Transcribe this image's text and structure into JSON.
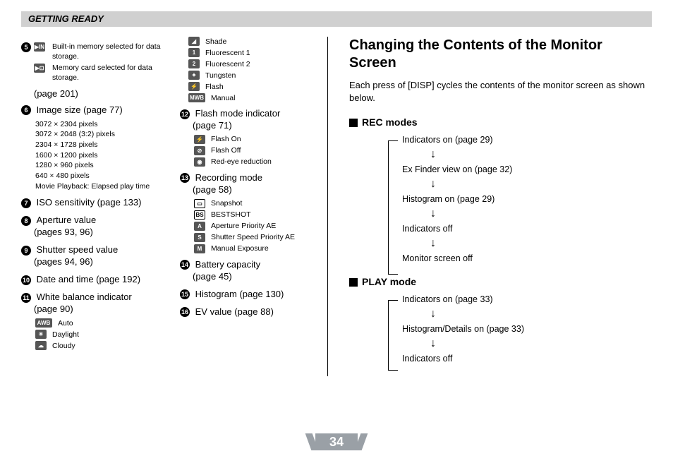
{
  "header": {
    "title": "GETTING READY"
  },
  "pageNumber": "34",
  "leftColumn": {
    "item5": {
      "num": "5",
      "memory1": {
        "icon": "IN",
        "text": "Built-in memory selected for data storage."
      },
      "memory2": {
        "icon": "⊡",
        "text": "Memory card selected for data storage."
      },
      "pageRef": "(page 201)"
    },
    "item6": {
      "num": "6",
      "label": "Image size (page 77)",
      "sizes": [
        "3072 × 2304 pixels",
        "3072 × 2048 (3:2) pixels",
        "2304 × 1728 pixels",
        "1600 × 1200 pixels",
        "1280 ×  960 pixels",
        " 640 ×  480 pixels",
        "Movie Playback: Elapsed play time"
      ]
    },
    "item7": {
      "num": "7",
      "label": "ISO sensitivity (page 133)"
    },
    "item8": {
      "num": "8",
      "label": "Aperture value",
      "sub": "(pages 93, 96)"
    },
    "item9": {
      "num": "9",
      "label": "Shutter speed value",
      "sub": "(pages 94, 96)"
    },
    "item10": {
      "num": "10",
      "label": "Date and time (page 192)"
    },
    "item11": {
      "num": "11",
      "label": "White balance indicator",
      "sub": "(page 90)",
      "options": [
        {
          "icon": "AWB",
          "label": "Auto"
        },
        {
          "icon": "☀",
          "label": "Daylight"
        },
        {
          "icon": "☁",
          "label": "Cloudy"
        }
      ]
    }
  },
  "midColumn": {
    "wbExtra": [
      {
        "icon": "◢",
        "label": "Shade"
      },
      {
        "icon": "1",
        "label": "Fluorescent 1"
      },
      {
        "icon": "2",
        "label": "Fluorescent 2"
      },
      {
        "icon": "✦",
        "label": "Tungsten"
      },
      {
        "icon": "⚡",
        "label": "Flash"
      },
      {
        "icon": "MWB",
        "label": "Manual"
      }
    ],
    "item12": {
      "num": "12",
      "label": "Flash mode indicator",
      "sub": "(page 71)",
      "options": [
        {
          "icon": "⚡",
          "label": "Flash On"
        },
        {
          "icon": "⊘",
          "label": "Flash Off"
        },
        {
          "icon": "◉",
          "label": "Red-eye reduction"
        }
      ]
    },
    "item13": {
      "num": "13",
      "label": "Recording mode",
      "sub": "(page 58)",
      "options": [
        {
          "icon": "▭",
          "label": "Snapshot"
        },
        {
          "icon": "BS",
          "label": "BESTSHOT"
        },
        {
          "icon": "A",
          "label": "Aperture Priority AE"
        },
        {
          "icon": "S",
          "label": "Shutter Speed Priority AE"
        },
        {
          "icon": "M",
          "label": "Manual Exposure"
        }
      ]
    },
    "item14": {
      "num": "14",
      "label": "Battery capacity",
      "sub": "(page 45)"
    },
    "item15": {
      "num": "15",
      "label": "Histogram (page 130)"
    },
    "item16": {
      "num": "16",
      "label": "EV value (page 88)"
    }
  },
  "rightColumn": {
    "title": "Changing the Contents of the Monitor Screen",
    "intro": "Each press of [DISP] cycles the contents of the monitor screen as shown below.",
    "recHead": "REC modes",
    "recFlow": [
      "Indicators on (page 29)",
      "Ex Finder view on (page 32)",
      "Histogram on (page 29)",
      "Indicators off",
      "Monitor screen off"
    ],
    "playHead": "PLAY mode",
    "playFlow": [
      "Indicators on (page 33)",
      "Histogram/Details on (page 33)",
      "Indicators off"
    ]
  }
}
